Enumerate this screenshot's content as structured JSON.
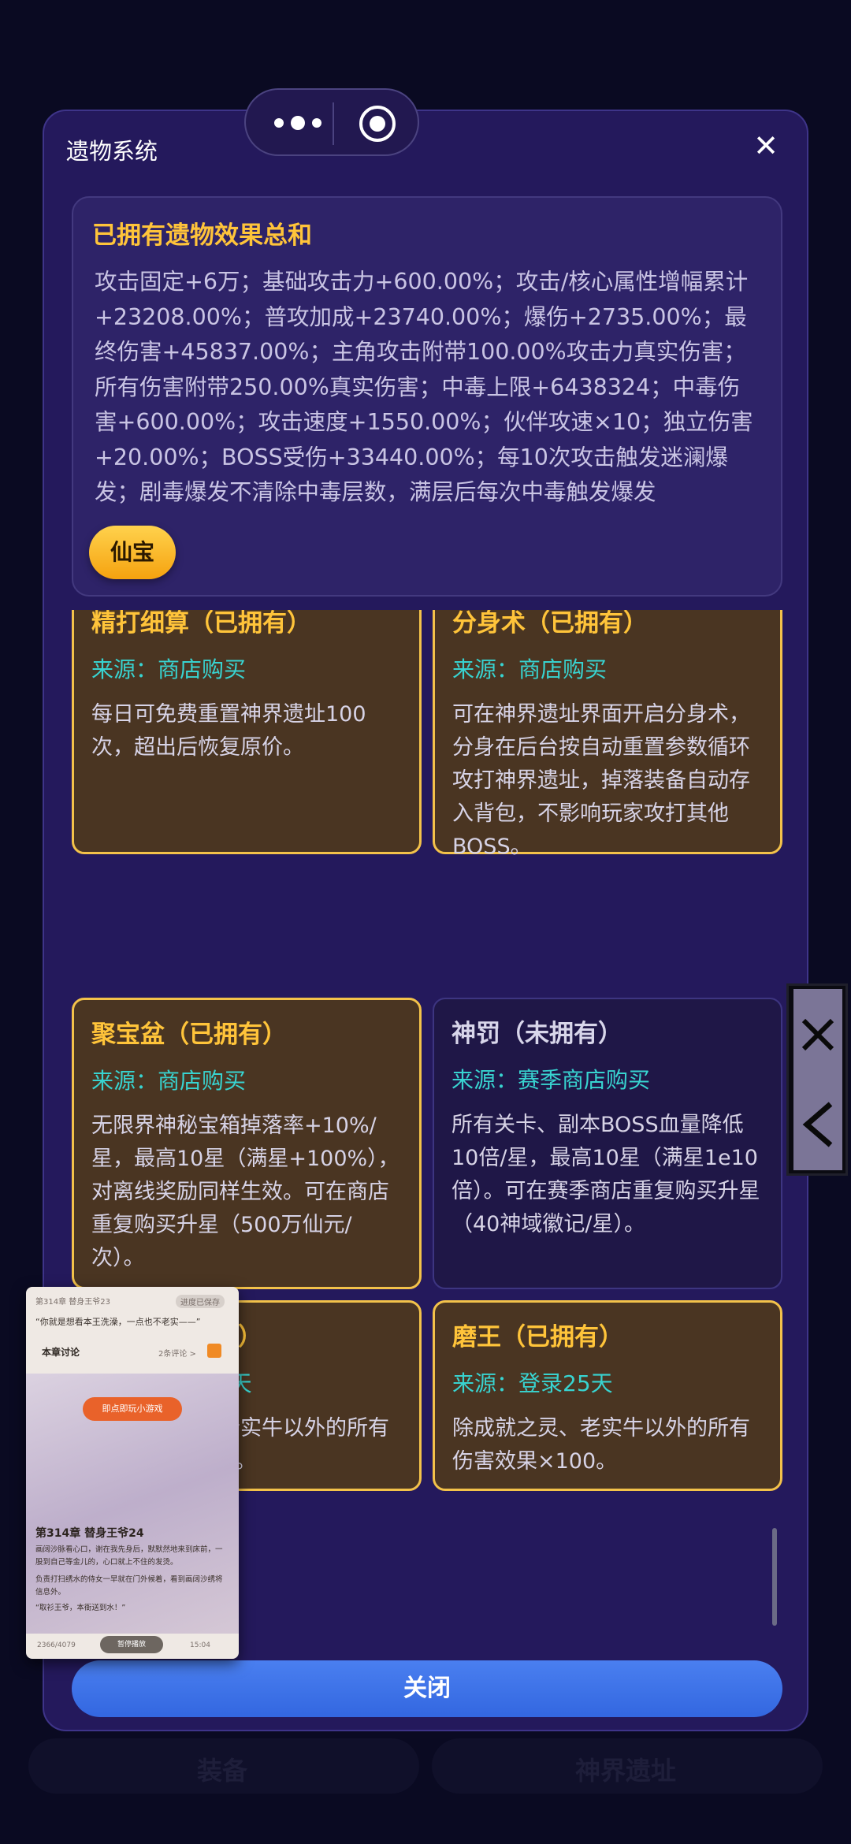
{
  "modal": {
    "title": "遗物系统",
    "close_icon": "✕",
    "close_button_label": "关闭"
  },
  "summary": {
    "title": "已拥有遗物效果总和",
    "text": "攻击固定+6万；基础攻击力+600.00%；攻击/核心属性增幅累计+23208.00%；普攻加成+23740.00%；爆伤+2735.00%；最终伤害+45837.00%；主角攻击附带100.00%攻击力真实伤害；所有伤害附带250.00%真实伤害；中毒上限+6438324；中毒伤害+600.00%；攻击速度+1550.00%；伙伴攻速×10；独立伤害+20.00%；BOSS受伤+33440.00%；每10次攻击触发迷澜爆发；剧毒爆发不清除中毒层数，满层后每次中毒触发爆发",
    "button_label": "仙宝"
  },
  "cards": [
    {
      "title": "精打细算（已拥有）",
      "source": "来源：商店购买",
      "desc": "每日可免费重置神界遗址100次，超出后恢复原价。",
      "owned": true
    },
    {
      "title": "分身术（已拥有）",
      "source": "来源：商店购买",
      "desc": "可在神界遗址界面开启分身术，分身在后台按自动重置参数循环攻打神界遗址，掉落装备自动存入背包，不影响玩家攻打其他BOSS。",
      "owned": true
    },
    {
      "title": "聚宝盆（已拥有）",
      "source": "来源：商店购买",
      "desc": "无限界神秘宝箱掉落率+10%/星，最高10星（满星+100%），对离线奖励同样生效。可在商店重复购买升星（500万仙元/次）。",
      "owned": true
    },
    {
      "title": "神罚（未拥有）",
      "source": "来源：赛季商店购买",
      "desc": "所有关卡、副本BOSS血量降低10倍/星，最高10星（满星1e10倍）。可在赛季商店重复购买升星（40神域徽记/星）。",
      "owned": false
    },
    {
      "title": "持久（已拥有）",
      "source": "来源：登录10天",
      "desc": "除成就之灵、老实牛以外的所有伤害效果×100。",
      "owned": true
    },
    {
      "title": "磨王（已拥有）",
      "source": "来源：登录25天",
      "desc": "除成就之灵、老实牛以外的所有伤害效果×100。",
      "owned": true
    }
  ],
  "background": {
    "bottom_left": "装备",
    "bottom_right": "神界遗址"
  },
  "capsule": {
    "more_icon": "more-dots-icon",
    "target_icon": "target-icon"
  },
  "pip": {
    "top_chip": "第314章 替身王爷23",
    "top_chip_right": "进度已保存",
    "quote": "“你就是想看本王洗澡，一点也不老实——”",
    "section": "本章讨论",
    "section_right": "2条评论 >",
    "play_button": "即点即玩小游戏",
    "chapter_title": "第314章 替身王爷24",
    "body1": "画阔沙脉看心口，谢在我先身后，默默然地来到床前，一股到自己等金儿的，心口就上不住的发烫。",
    "body2": "负责打扫绣水的侍女一早就在门外候着，看到画阔沙绣将信息外。",
    "body3": "“取衫王爷，本衙送到水！”",
    "footer_left": "2366/4079",
    "footer_mid": "暂停播放",
    "footer_right": "15:04"
  }
}
